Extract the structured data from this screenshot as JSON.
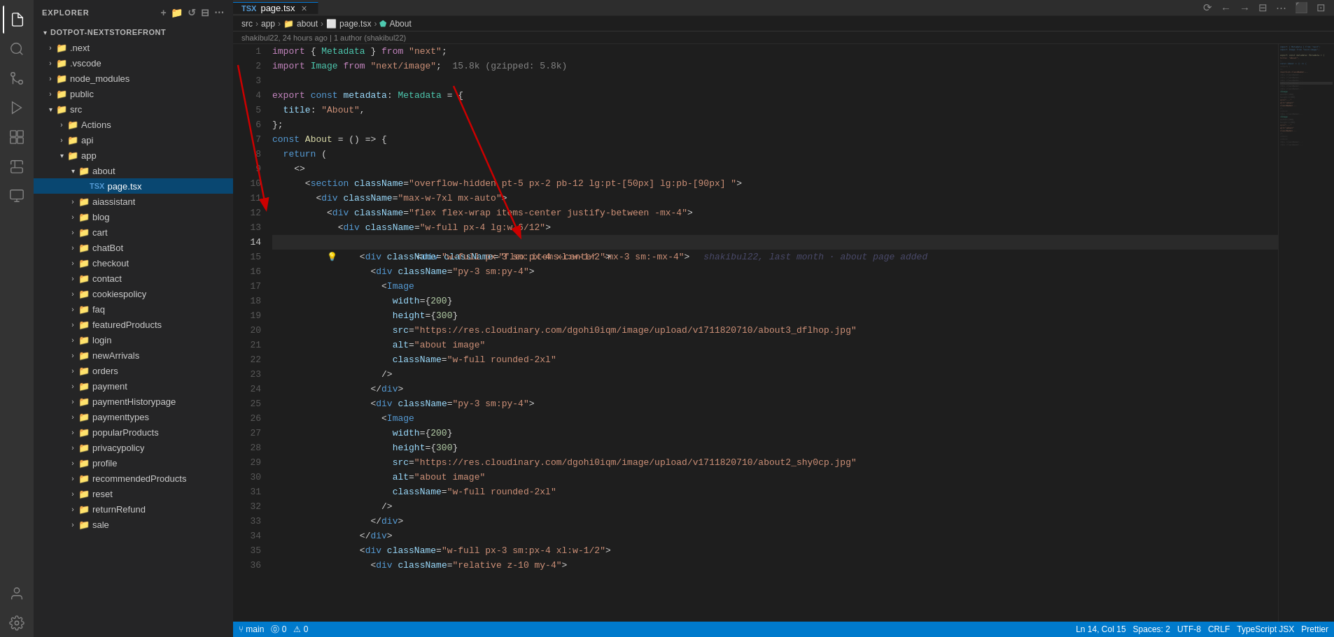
{
  "titlebar": {
    "label": "EXPLORER"
  },
  "activity_bar": {
    "icons": [
      {
        "name": "files-icon",
        "symbol": "⬜",
        "active": false
      },
      {
        "name": "search-icon",
        "symbol": "🔍",
        "active": false
      },
      {
        "name": "source-control-icon",
        "symbol": "⑂",
        "active": false
      },
      {
        "name": "run-debug-icon",
        "symbol": "▷",
        "active": false
      },
      {
        "name": "extensions-icon",
        "symbol": "⊞",
        "active": false
      },
      {
        "name": "test-icon",
        "symbol": "⚗",
        "active": false
      },
      {
        "name": "remote-icon",
        "symbol": "⧉",
        "active": false
      },
      {
        "name": "settings-icon",
        "symbol": "⚙",
        "active": false
      },
      {
        "name": "account-icon",
        "symbol": "👤",
        "active": false
      }
    ]
  },
  "sidebar": {
    "title": "EXPLORER",
    "root": "DOTPOT-NEXTSTOREFRONT",
    "items": [
      {
        "id": "next",
        "label": ".next",
        "type": "folder",
        "depth": 1,
        "collapsed": true
      },
      {
        "id": "vscode",
        "label": ".vscode",
        "type": "folder",
        "depth": 1,
        "collapsed": true
      },
      {
        "id": "node_modules",
        "label": "node_modules",
        "type": "folder",
        "depth": 1,
        "collapsed": true
      },
      {
        "id": "public",
        "label": "public",
        "type": "folder",
        "depth": 1,
        "collapsed": true
      },
      {
        "id": "src",
        "label": "src",
        "type": "folder",
        "depth": 1,
        "collapsed": false
      },
      {
        "id": "Actions",
        "label": "Actions",
        "type": "folder",
        "depth": 2,
        "collapsed": true
      },
      {
        "id": "api",
        "label": "api",
        "type": "folder",
        "depth": 2,
        "collapsed": true
      },
      {
        "id": "app",
        "label": "app",
        "type": "folder",
        "depth": 2,
        "collapsed": false
      },
      {
        "id": "about",
        "label": "about",
        "type": "folder",
        "depth": 3,
        "collapsed": false
      },
      {
        "id": "page.tsx",
        "label": "page.tsx",
        "type": "file",
        "depth": 4,
        "selected": true,
        "icon": "tsx"
      },
      {
        "id": "aiassistant",
        "label": "aiassistant",
        "type": "folder",
        "depth": 3,
        "collapsed": true
      },
      {
        "id": "blog",
        "label": "blog",
        "type": "folder",
        "depth": 3,
        "collapsed": true
      },
      {
        "id": "cart",
        "label": "cart",
        "type": "folder",
        "depth": 3,
        "collapsed": true
      },
      {
        "id": "chatBot",
        "label": "chatBot",
        "type": "folder",
        "depth": 3,
        "collapsed": true
      },
      {
        "id": "checkout",
        "label": "checkout",
        "type": "folder",
        "depth": 3,
        "collapsed": true
      },
      {
        "id": "contact",
        "label": "contact",
        "type": "folder",
        "depth": 3,
        "collapsed": true
      },
      {
        "id": "cookiespolicy",
        "label": "cookiespolicy",
        "type": "folder",
        "depth": 3,
        "collapsed": true
      },
      {
        "id": "faq",
        "label": "faq",
        "type": "folder",
        "depth": 3,
        "collapsed": true
      },
      {
        "id": "featuredProducts",
        "label": "featuredProducts",
        "type": "folder",
        "depth": 3,
        "collapsed": true
      },
      {
        "id": "login",
        "label": "login",
        "type": "folder",
        "depth": 3,
        "collapsed": true
      },
      {
        "id": "newArrivals",
        "label": "newArrivals",
        "type": "folder",
        "depth": 3,
        "collapsed": true
      },
      {
        "id": "orders",
        "label": "orders",
        "type": "folder",
        "depth": 3,
        "collapsed": true
      },
      {
        "id": "payment",
        "label": "payment",
        "type": "folder",
        "depth": 3,
        "collapsed": true
      },
      {
        "id": "paymentHistorypage",
        "label": "paymentHistorypage",
        "type": "folder",
        "depth": 3,
        "collapsed": true
      },
      {
        "id": "paymenttypes",
        "label": "paymenttypes",
        "type": "folder",
        "depth": 3,
        "collapsed": true
      },
      {
        "id": "popularProducts",
        "label": "popularProducts",
        "type": "folder",
        "depth": 3,
        "collapsed": true
      },
      {
        "id": "privacypolicy",
        "label": "privacypolicy",
        "type": "folder",
        "depth": 3,
        "collapsed": true
      },
      {
        "id": "profile",
        "label": "profile",
        "type": "folder",
        "depth": 3,
        "collapsed": true
      },
      {
        "id": "recommendedProducts",
        "label": "recommendedProducts",
        "type": "folder",
        "depth": 3,
        "collapsed": true
      },
      {
        "id": "reset",
        "label": "reset",
        "type": "folder",
        "depth": 3,
        "collapsed": true
      },
      {
        "id": "returnRefund",
        "label": "returnRefund",
        "type": "folder",
        "depth": 3,
        "collapsed": true
      },
      {
        "id": "sale",
        "label": "sale",
        "type": "folder",
        "depth": 3,
        "collapsed": true
      }
    ]
  },
  "tab": {
    "filename": "page.tsx",
    "icon": "tsx"
  },
  "breadcrumb": {
    "parts": [
      "src",
      "app",
      "about",
      "page.tsx",
      "About"
    ]
  },
  "git_info": {
    "text": "shakibul22, 24 hours ago | 1 author (shakibul22)"
  },
  "editor": {
    "lines": [
      {
        "num": 1,
        "content": "import { Metadata } from \"next\";"
      },
      {
        "num": 2,
        "content": "import Image from \"next/image\";  15.8k (gzipped: 5.8k)"
      },
      {
        "num": 3,
        "content": ""
      },
      {
        "num": 4,
        "content": "export const metadata: Metadata = {"
      },
      {
        "num": 5,
        "content": "  title: \"About\","
      },
      {
        "num": 6,
        "content": "};"
      },
      {
        "num": 7,
        "content": "const About = () => {"
      },
      {
        "num": 8,
        "content": "  return ("
      },
      {
        "num": 9,
        "content": "    <>"
      },
      {
        "num": 10,
        "content": "      <section className=\"overflow-hidden pt-5 px-2 pb-12 lg:pt-[50px] lg:pb-[90px] \">"
      },
      {
        "num": 11,
        "content": "        <div className=\"max-w-7xl mx-auto\">"
      },
      {
        "num": 12,
        "content": "          <div className=\"flex flex-wrap items-center justify-between -mx-4\">"
      },
      {
        "num": 13,
        "content": "            <div className=\"w-full px-4 lg:w-6/12\">"
      },
      {
        "num": 14,
        "content": "              <div className=\"flex items-center -mx-3 sm:-mx-4\">",
        "blame": "shakibul22, last month · about page added",
        "hint": true
      },
      {
        "num": 15,
        "content": "                <div className=\"w-full px-3 sm:px-4 xl:w-1/2\">"
      },
      {
        "num": 16,
        "content": "                  <div className=\"py-3 sm:py-4\">"
      },
      {
        "num": 17,
        "content": "                    <Image"
      },
      {
        "num": 18,
        "content": "                      width={200}"
      },
      {
        "num": 19,
        "content": "                      height={300}"
      },
      {
        "num": 20,
        "content": "                      src=\"https://res.cloudinary.com/dgohi0iqm/image/upload/v1711820710/about3_dflhop.jpg\""
      },
      {
        "num": 21,
        "content": "                      alt=\"about image\""
      },
      {
        "num": 22,
        "content": "                      className=\"w-full rounded-2xl\""
      },
      {
        "num": 23,
        "content": "                    />"
      },
      {
        "num": 24,
        "content": "                  </div>"
      },
      {
        "num": 25,
        "content": "                  <div className=\"py-3 sm:py-4\">"
      },
      {
        "num": 26,
        "content": "                    <Image"
      },
      {
        "num": 27,
        "content": "                      width={200}"
      },
      {
        "num": 28,
        "content": "                      height={300}"
      },
      {
        "num": 29,
        "content": "                      src=\"https://res.cloudinary.com/dgohi0iqm/image/upload/v1711820710/about2_shy0cp.jpg\""
      },
      {
        "num": 30,
        "content": "                      alt=\"about image\""
      },
      {
        "num": 31,
        "content": "                      className=\"w-full rounded-2xl\""
      },
      {
        "num": 32,
        "content": "                    />"
      },
      {
        "num": 33,
        "content": "                  </div>"
      },
      {
        "num": 34,
        "content": "                </div>"
      },
      {
        "num": 35,
        "content": "                <div className=\"w-full px-3 sm:px-4 xl:w-1/2\">"
      },
      {
        "num": 36,
        "content": "                  <div className=\"relative z-10 my-4\">"
      }
    ]
  },
  "top_bar_icons": [
    {
      "name": "history-icon",
      "symbol": "⟳"
    },
    {
      "name": "split-icon",
      "symbol": "⧉"
    },
    {
      "name": "layout-icon",
      "symbol": "⊟"
    },
    {
      "name": "more-icon",
      "symbol": "⋯"
    },
    {
      "name": "panel-icon",
      "symbol": "⬜"
    },
    {
      "name": "maximize-icon",
      "symbol": "⊡"
    }
  ],
  "status_bar": {
    "left": [
      "⑂ main",
      "⓪ 0",
      "⚠ 0"
    ],
    "right": [
      "Ln 14, Col 15",
      "Spaces: 2",
      "UTF-8",
      "CRLF",
      "TypeScript JSX",
      "Prettier"
    ]
  }
}
